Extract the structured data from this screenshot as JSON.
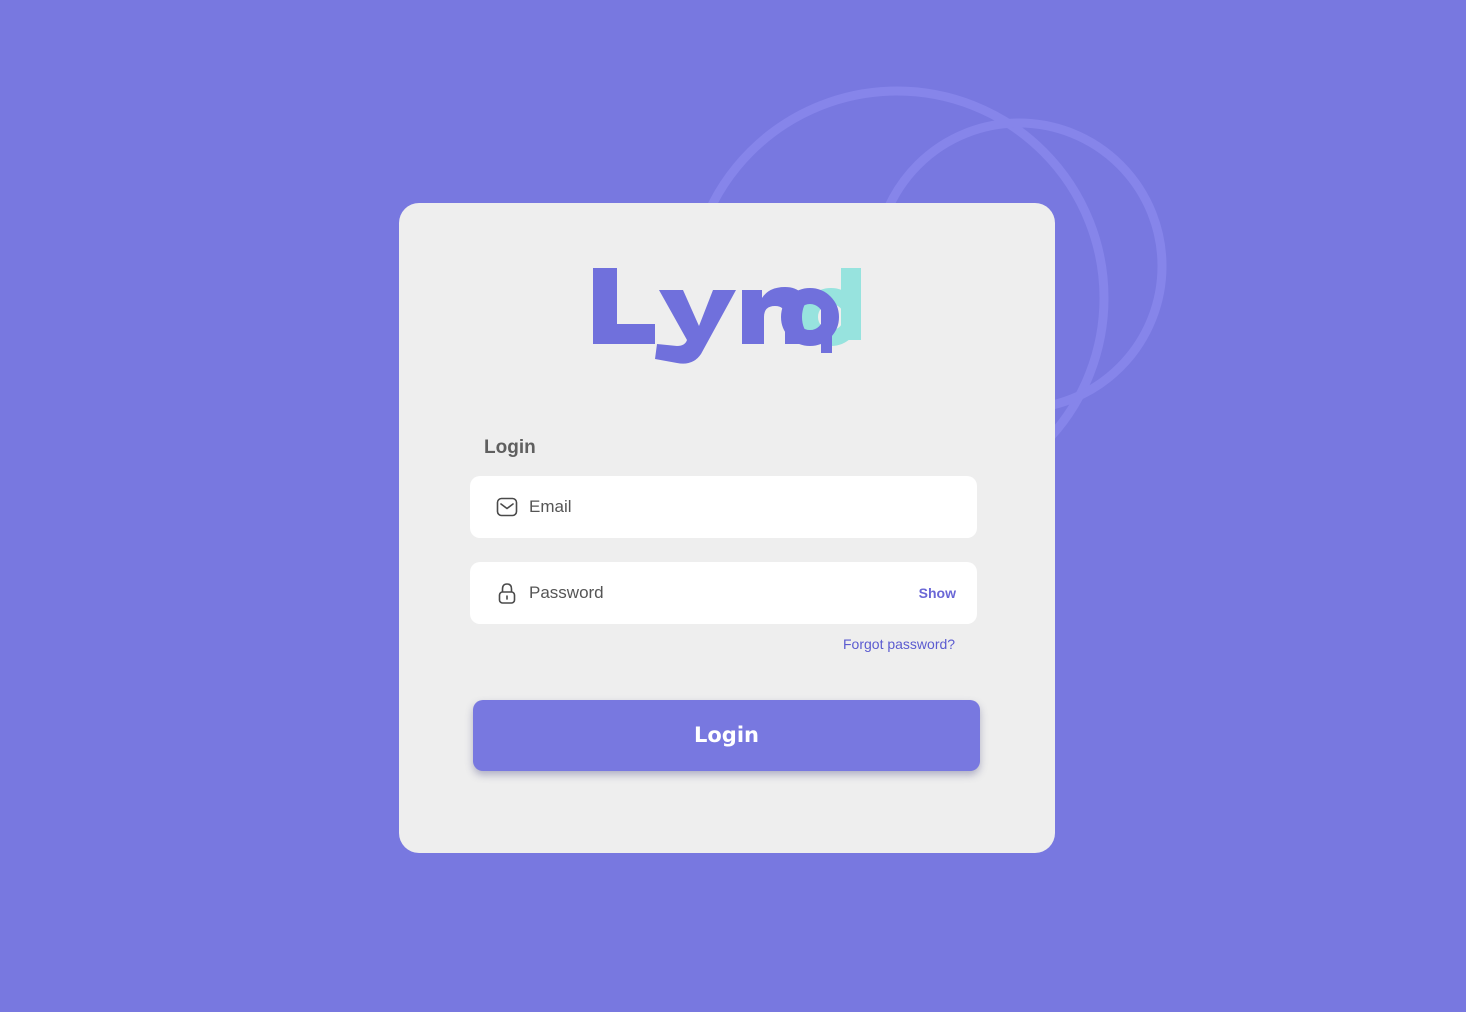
{
  "brand": {
    "logo_text": "Lynqd",
    "primary_color": "#7878e0",
    "accent_color": "#97e3de",
    "background_color": "#7878e0",
    "card_color": "#eeeeee"
  },
  "form": {
    "title": "Login",
    "email": {
      "placeholder": "Email",
      "value": "",
      "icon": "mail-icon"
    },
    "password": {
      "placeholder": "Password",
      "value": "",
      "icon": "lock-icon",
      "toggle_label": "Show"
    },
    "forgot_password_label": "Forgot password?",
    "submit_label": "Login"
  }
}
